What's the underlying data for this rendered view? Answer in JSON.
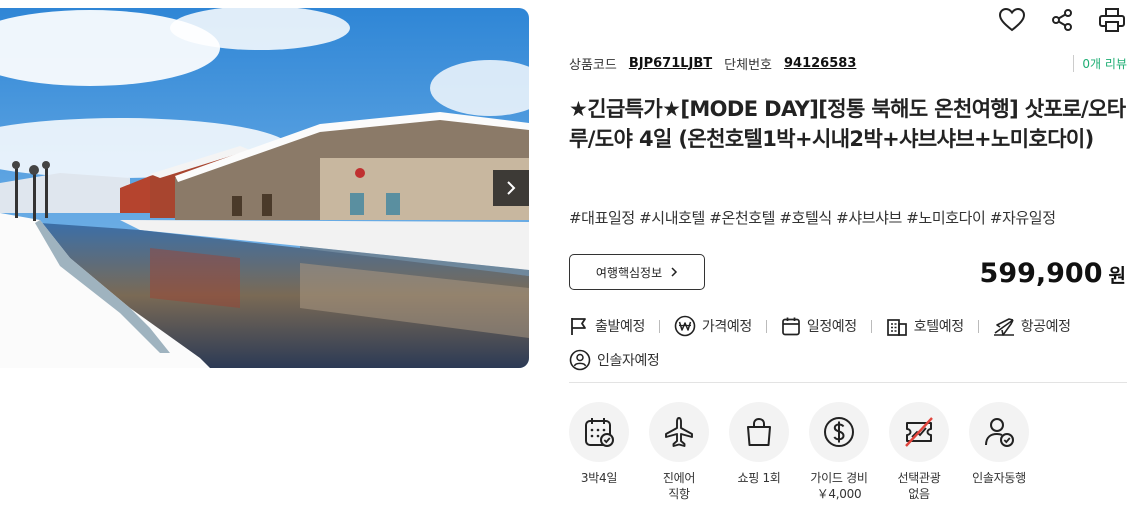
{
  "codes": {
    "product_code_label": "상품코드",
    "product_code": "BJP671LJBT",
    "group_no_label": "단체번호",
    "group_no": "94126583",
    "review_count": "0개 리뷰"
  },
  "title": "★긴급특가★[MODE DAY][정통 북해도 온천여행] 삿포로/오타루/도야 4일 (온천호텔1박+시내2박+샤브샤브+노미호다이)",
  "tags": "#대표일정 #시내호텔 #온천호텔 #호텔식 #샤브샤브 #노미호다이 #자유일정",
  "core_info_button": "여행핵심정보",
  "price": {
    "amount": "599,900",
    "unit": "원"
  },
  "notices": [
    {
      "label": "출발예정",
      "icon": "flag-icon"
    },
    {
      "label": "가격예정",
      "icon": "won-icon"
    },
    {
      "label": "일정예정",
      "icon": "calendar-icon"
    },
    {
      "label": "호텔예정",
      "icon": "building-icon"
    },
    {
      "label": "항공예정",
      "icon": "airplane-icon"
    },
    {
      "label": "인솔자예정",
      "icon": "person-icon"
    }
  ],
  "features": [
    {
      "line1": "3박4일",
      "line2": "",
      "icon": "calendar-check-icon"
    },
    {
      "line1": "진에어",
      "line2": "직항",
      "icon": "airplane-icon"
    },
    {
      "line1": "쇼핑 1회",
      "line2": "",
      "icon": "shopping-bag-icon"
    },
    {
      "line1": "가이드 경비",
      "line2": "￥4,000",
      "icon": "dollar-icon"
    },
    {
      "line1": "선택관광",
      "line2": "없음",
      "icon": "ticket-none-icon"
    },
    {
      "line1": "인솔자동행",
      "line2": "",
      "icon": "guide-person-icon"
    }
  ],
  "colors": {
    "review": "#1fae74",
    "accent_red": "#e0443c"
  }
}
